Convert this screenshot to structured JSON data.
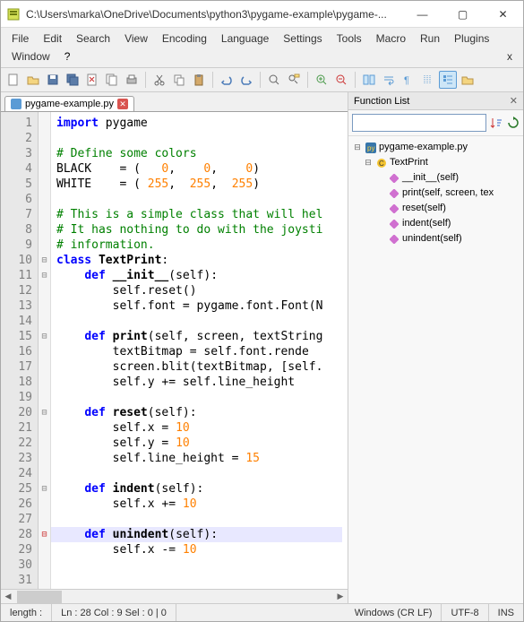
{
  "window": {
    "title": "C:\\Users\\marka\\OneDrive\\Documents\\python3\\pygame-example\\pygame-..."
  },
  "menu": {
    "items": [
      "File",
      "Edit",
      "Search",
      "View",
      "Encoding",
      "Language",
      "Settings",
      "Tools",
      "Macro",
      "Run",
      "Plugins",
      "Window"
    ],
    "help": "?",
    "right": "x"
  },
  "tab": {
    "name": "pygame-example.py"
  },
  "code": {
    "lines": [
      {
        "n": 1,
        "t": [
          [
            "kw",
            "import"
          ],
          [
            "id",
            " pygame"
          ]
        ]
      },
      {
        "n": 2,
        "t": []
      },
      {
        "n": 3,
        "t": [
          [
            "cm",
            "# Define some colors"
          ]
        ]
      },
      {
        "n": 4,
        "t": [
          [
            "id",
            "BLACK    "
          ],
          [
            "op",
            "= ("
          ],
          [
            "nm",
            "   0"
          ],
          [
            "op",
            ", "
          ],
          [
            "nm",
            "   0"
          ],
          [
            "op",
            ", "
          ],
          [
            "nm",
            "   0"
          ],
          [
            "op",
            ")"
          ]
        ]
      },
      {
        "n": 5,
        "t": [
          [
            "id",
            "WHITE    "
          ],
          [
            "op",
            "= ("
          ],
          [
            "nm",
            " 255"
          ],
          [
            "op",
            ", "
          ],
          [
            "nm",
            " 255"
          ],
          [
            "op",
            ", "
          ],
          [
            "nm",
            " 255"
          ],
          [
            "op",
            ")"
          ]
        ]
      },
      {
        "n": 6,
        "t": []
      },
      {
        "n": 7,
        "t": [
          [
            "cm",
            "# This is a simple class that will hel"
          ]
        ]
      },
      {
        "n": 8,
        "t": [
          [
            "cm",
            "# It has nothing to do with the joysti"
          ]
        ]
      },
      {
        "n": 9,
        "t": [
          [
            "cm",
            "# information."
          ]
        ]
      },
      {
        "n": 10,
        "t": [
          [
            "kw",
            "class"
          ],
          [
            "id",
            " "
          ],
          [
            "fn",
            "TextPrint"
          ],
          [
            "op",
            ":"
          ]
        ],
        "fold": "⊟"
      },
      {
        "n": 11,
        "t": [
          [
            "id",
            "    "
          ],
          [
            "kw",
            "def"
          ],
          [
            "id",
            " "
          ],
          [
            "fn",
            "__init__"
          ],
          [
            "op",
            "("
          ],
          [
            "id",
            "self"
          ],
          [
            "op",
            "):"
          ]
        ],
        "fold": "⊟"
      },
      {
        "n": 12,
        "t": [
          [
            "id",
            "        self.reset"
          ],
          [
            "op",
            "()"
          ]
        ]
      },
      {
        "n": 13,
        "t": [
          [
            "id",
            "        self.font "
          ],
          [
            "op",
            "="
          ],
          [
            "id",
            " pygame.font.Font"
          ],
          [
            "op",
            "("
          ],
          [
            "id",
            "N"
          ]
        ]
      },
      {
        "n": 14,
        "t": []
      },
      {
        "n": 15,
        "t": [
          [
            "id",
            "    "
          ],
          [
            "kw",
            "def"
          ],
          [
            "id",
            " "
          ],
          [
            "fn",
            "print"
          ],
          [
            "op",
            "("
          ],
          [
            "id",
            "self, screen, textString"
          ]
        ],
        "fold": "⊟"
      },
      {
        "n": 16,
        "t": [
          [
            "id",
            "        textBitmap "
          ],
          [
            "op",
            "="
          ],
          [
            "id",
            " self.font.rende"
          ]
        ]
      },
      {
        "n": 17,
        "t": [
          [
            "id",
            "        screen.blit"
          ],
          [
            "op",
            "("
          ],
          [
            "id",
            "textBitmap, "
          ],
          [
            "op",
            "["
          ],
          [
            "id",
            "self."
          ]
        ]
      },
      {
        "n": 18,
        "t": [
          [
            "id",
            "        self.y "
          ],
          [
            "op",
            "+="
          ],
          [
            "id",
            " self.line_height"
          ]
        ]
      },
      {
        "n": 19,
        "t": []
      },
      {
        "n": 20,
        "t": [
          [
            "id",
            "    "
          ],
          [
            "kw",
            "def"
          ],
          [
            "id",
            " "
          ],
          [
            "fn",
            "reset"
          ],
          [
            "op",
            "("
          ],
          [
            "id",
            "self"
          ],
          [
            "op",
            "):"
          ]
        ],
        "fold": "⊟"
      },
      {
        "n": 21,
        "t": [
          [
            "id",
            "        self.x "
          ],
          [
            "op",
            "="
          ],
          [
            "id",
            " "
          ],
          [
            "nm",
            "10"
          ]
        ]
      },
      {
        "n": 22,
        "t": [
          [
            "id",
            "        self.y "
          ],
          [
            "op",
            "="
          ],
          [
            "id",
            " "
          ],
          [
            "nm",
            "10"
          ]
        ]
      },
      {
        "n": 23,
        "t": [
          [
            "id",
            "        self.line_height "
          ],
          [
            "op",
            "="
          ],
          [
            "id",
            " "
          ],
          [
            "nm",
            "15"
          ]
        ]
      },
      {
        "n": 24,
        "t": []
      },
      {
        "n": 25,
        "t": [
          [
            "id",
            "    "
          ],
          [
            "kw",
            "def"
          ],
          [
            "id",
            " "
          ],
          [
            "fn",
            "indent"
          ],
          [
            "op",
            "("
          ],
          [
            "id",
            "self"
          ],
          [
            "op",
            "):"
          ]
        ],
        "fold": "⊟"
      },
      {
        "n": 26,
        "t": [
          [
            "id",
            "        self.x "
          ],
          [
            "op",
            "+="
          ],
          [
            "id",
            " "
          ],
          [
            "nm",
            "10"
          ]
        ]
      },
      {
        "n": 27,
        "t": []
      },
      {
        "n": 28,
        "t": [
          [
            "id",
            "    "
          ],
          [
            "kw",
            "def"
          ],
          [
            "id",
            " "
          ],
          [
            "fn",
            "unindent"
          ],
          [
            "op",
            "("
          ],
          [
            "id",
            "self"
          ],
          [
            "op",
            "):"
          ]
        ],
        "fold": "⊟",
        "hl": true
      },
      {
        "n": 29,
        "t": [
          [
            "id",
            "        self.x "
          ],
          [
            "op",
            "-="
          ],
          [
            "id",
            " "
          ],
          [
            "nm",
            "10"
          ]
        ]
      },
      {
        "n": 30,
        "t": []
      },
      {
        "n": 31,
        "t": []
      }
    ]
  },
  "functionList": {
    "title": "Function List",
    "root": "pygame-example.py",
    "class": "TextPrint",
    "methods": [
      "__init__(self)",
      "print(self, screen, tex",
      "reset(self)",
      "indent(self)",
      "unindent(self)"
    ]
  },
  "status": {
    "length": "length :",
    "pos": "Ln : 28    Col : 9    Sel : 0 | 0",
    "eol": "Windows (CR LF)",
    "enc": "UTF-8",
    "ins": "INS"
  }
}
